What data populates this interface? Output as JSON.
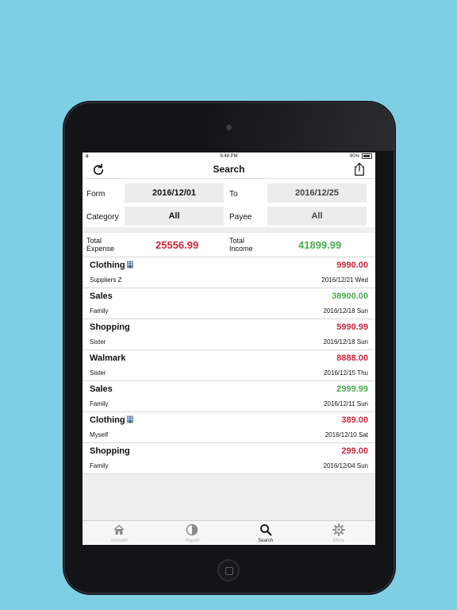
{
  "status_bar": {
    "signal": "✈",
    "time": "9:48 PM",
    "battery": "90%"
  },
  "nav": {
    "title": "Search",
    "refresh_icon": "refresh-icon",
    "share_icon": "share-icon"
  },
  "filters": {
    "from_label": "Form",
    "from_value": "2016/12/01",
    "to_label": "To",
    "to_value": "2016/12/25",
    "category_label": "Category",
    "category_value": "All",
    "payee_label": "Payee",
    "payee_value": "All"
  },
  "totals": {
    "expense_label_1": "Total",
    "expense_label_2": "Expense",
    "expense_value": "25556.99",
    "income_label_1": "Total",
    "income_label_2": "Income",
    "income_value": "41899.99"
  },
  "transactions": [
    {
      "category": "Clothing",
      "amount": "9990.00",
      "type": "expense",
      "payee": "Suppliers Z",
      "date": "2016/12/21 Wed",
      "icon": "building-icon"
    },
    {
      "category": "Sales",
      "amount": "38900.00",
      "type": "income",
      "payee": "Family",
      "date": "2016/12/18 Sun"
    },
    {
      "category": "Shopping",
      "amount": "5990.99",
      "type": "expense",
      "payee": "Sister",
      "date": "2016/12/18 Sun"
    },
    {
      "category": "Walmark",
      "amount": "8888.00",
      "type": "expense",
      "payee": "Sister",
      "date": "2016/12/15 Thu"
    },
    {
      "category": "Sales",
      "amount": "2999.99",
      "type": "income",
      "payee": "Family",
      "date": "2016/12/11 Sun"
    },
    {
      "category": "Clothing",
      "amount": "389.00",
      "type": "expense",
      "payee": "Myself",
      "date": "2016/12/10 Sat",
      "icon": "building-icon"
    },
    {
      "category": "Shopping",
      "amount": "299.00",
      "type": "expense",
      "payee": "Family",
      "date": "2016/12/04 Sun"
    }
  ],
  "tabs": [
    {
      "label": "Account",
      "icon": "home-icon"
    },
    {
      "label": "Report",
      "icon": "pie-chart-icon"
    },
    {
      "label": "Search",
      "icon": "search-icon",
      "active": true
    },
    {
      "label": "More",
      "icon": "gear-icon"
    }
  ],
  "colors": {
    "expense": "#c9283c",
    "income": "#4caa55",
    "background": "#7ecfe4"
  }
}
